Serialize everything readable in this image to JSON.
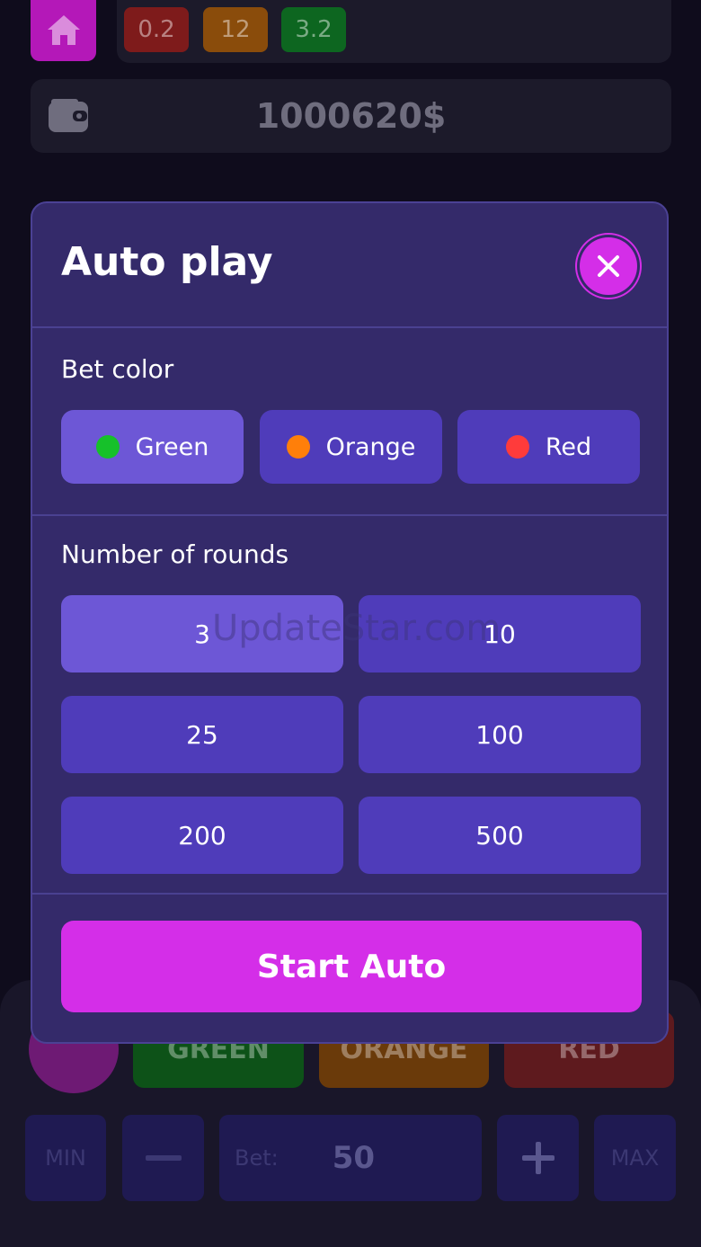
{
  "history": {
    "chips": [
      {
        "value": "0.2",
        "color": "red"
      },
      {
        "value": "12",
        "color": "orange"
      },
      {
        "value": "3.2",
        "color": "green"
      }
    ]
  },
  "wallet": {
    "balance": "1000620$"
  },
  "controls": {
    "colors": [
      "GREEN",
      "ORANGE",
      "RED"
    ],
    "min_label": "MIN",
    "max_label": "MAX",
    "bet_label": "Bet:",
    "bet_value": "50"
  },
  "modal": {
    "title": "Auto play",
    "bet_color_label": "Bet color",
    "color_options": [
      {
        "label": "Green",
        "dot": "#16c12a",
        "selected": true
      },
      {
        "label": "Orange",
        "dot": "#ff7f0a",
        "selected": false
      },
      {
        "label": "Red",
        "dot": "#ff3b3b",
        "selected": false
      }
    ],
    "rounds_label": "Number of rounds",
    "round_options": [
      "3",
      "10",
      "25",
      "100",
      "200",
      "500"
    ],
    "selected_round": "3",
    "watermark": "UpdateStar.com",
    "start_label": "Start Auto"
  },
  "colors": {
    "accent": "#d42ee8",
    "panel": "#342a6a",
    "option": "#4f3cba",
    "option_selected": "#6d57d6"
  }
}
